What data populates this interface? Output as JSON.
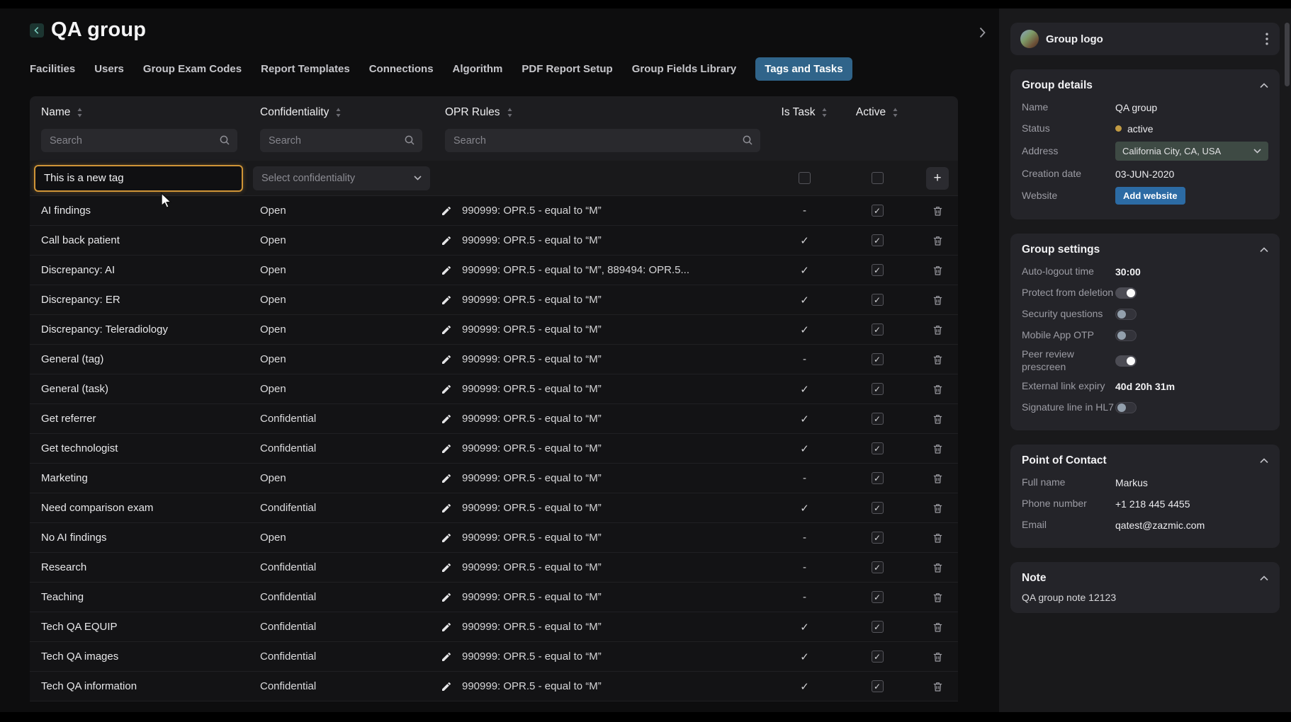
{
  "header": {
    "title": "QA group"
  },
  "tabs": {
    "items": [
      {
        "label": "Facilities",
        "active": false
      },
      {
        "label": "Users",
        "active": false
      },
      {
        "label": "Group Exam Codes",
        "active": false
      },
      {
        "label": "Report Templates",
        "active": false
      },
      {
        "label": "Connections",
        "active": false
      },
      {
        "label": "Algorithm",
        "active": false
      },
      {
        "label": "PDF Report Setup",
        "active": false
      },
      {
        "label": "Group Fields Library",
        "active": false
      },
      {
        "label": "Tags and Tasks",
        "active": true
      }
    ]
  },
  "table": {
    "columns": [
      {
        "label": "Name"
      },
      {
        "label": "Confidentiality"
      },
      {
        "label": "OPR Rules"
      },
      {
        "label": "Is Task"
      },
      {
        "label": "Active"
      }
    ],
    "search_placeholder": "Search",
    "glyphs": {
      "task_yes": "✓",
      "task_no": "-"
    },
    "new_row": {
      "name_value": "This is a new tag",
      "confidentiality_placeholder": "Select confidentiality",
      "add_label": "+"
    },
    "rows": [
      {
        "name": "AI findings",
        "confidentiality": "Open",
        "opr_rules": "990999: OPR.5 - equal to “M”",
        "is_task": false,
        "active": true
      },
      {
        "name": "Call back patient",
        "confidentiality": "Open",
        "opr_rules": "990999: OPR.5 - equal to “M”",
        "is_task": true,
        "active": true
      },
      {
        "name": "Discrepancy: AI",
        "confidentiality": "Open",
        "opr_rules": "990999: OPR.5 - equal to “M”, 889494: OPR.5...",
        "is_task": true,
        "active": true
      },
      {
        "name": "Discrepancy: ER",
        "confidentiality": "Open",
        "opr_rules": "990999: OPR.5 - equal to “M”",
        "is_task": true,
        "active": true
      },
      {
        "name": "Discrepancy: Teleradiology",
        "confidentiality": "Open",
        "opr_rules": "990999: OPR.5 - equal to “M”",
        "is_task": true,
        "active": true
      },
      {
        "name": "General (tag)",
        "confidentiality": "Open",
        "opr_rules": "990999: OPR.5 - equal to “M”",
        "is_task": false,
        "active": true
      },
      {
        "name": "General (task)",
        "confidentiality": "Open",
        "opr_rules": "990999: OPR.5 - equal to “M”",
        "is_task": true,
        "active": true
      },
      {
        "name": "Get referrer",
        "confidentiality": "Confidential",
        "opr_rules": "990999: OPR.5 - equal to “M”",
        "is_task": true,
        "active": true
      },
      {
        "name": "Get technologist",
        "confidentiality": "Confidential",
        "opr_rules": "990999: OPR.5 - equal to “M”",
        "is_task": true,
        "active": true
      },
      {
        "name": "Marketing",
        "confidentiality": "Open",
        "opr_rules": "990999: OPR.5 - equal to “M”",
        "is_task": false,
        "active": true
      },
      {
        "name": "Need comparison exam",
        "confidentiality": "Condifential",
        "opr_rules": "990999: OPR.5 - equal to “M”",
        "is_task": true,
        "active": true
      },
      {
        "name": "No AI findings",
        "confidentiality": "Open",
        "opr_rules": "990999: OPR.5 - equal to “M”",
        "is_task": false,
        "active": true
      },
      {
        "name": "Research",
        "confidentiality": "Confidential",
        "opr_rules": "990999: OPR.5 - equal to “M”",
        "is_task": false,
        "active": true
      },
      {
        "name": "Teaching",
        "confidentiality": "Confidential",
        "opr_rules": "990999: OPR.5 - equal to “M”",
        "is_task": false,
        "active": true
      },
      {
        "name": "Tech QA EQUIP",
        "confidentiality": "Confidential",
        "opr_rules": "990999: OPR.5 - equal to “M”",
        "is_task": true,
        "active": true
      },
      {
        "name": "Tech QA images",
        "confidentiality": "Confidential",
        "opr_rules": "990999: OPR.5 - equal to “M”",
        "is_task": true,
        "active": true
      },
      {
        "name": "Tech QA information",
        "confidentiality": "Confidential",
        "opr_rules": "990999: OPR.5 - equal to “M”",
        "is_task": true,
        "active": true
      }
    ]
  },
  "panel": {
    "logo_label": "Group logo",
    "group_details": {
      "title": "Group details",
      "fields": [
        {
          "label": "Name",
          "type": "text",
          "value": "QA group"
        },
        {
          "label": "Status",
          "type": "status",
          "value": "active"
        },
        {
          "label": "Address",
          "type": "select",
          "value": "California City, CA, USA"
        },
        {
          "label": "Creation date",
          "type": "text",
          "value": "03-JUN-2020"
        },
        {
          "label": "Website",
          "type": "button",
          "value": "Add website"
        }
      ]
    },
    "group_settings": {
      "title": "Group settings",
      "rows": [
        {
          "label": "Auto-logout time",
          "type": "text",
          "value": "30:00"
        },
        {
          "label": "Protect from deletion",
          "type": "toggle",
          "on": true
        },
        {
          "label": "Security questions",
          "type": "toggle",
          "on": false
        },
        {
          "label": "Mobile App OTP",
          "type": "toggle",
          "on": false
        },
        {
          "label": "Peer review prescreen",
          "type": "toggle",
          "on": true
        },
        {
          "label": "External link expiry",
          "type": "text",
          "value": "40d 20h 31m"
        },
        {
          "label": "Signature line in HL7",
          "type": "toggle",
          "on": false
        }
      ]
    },
    "point_of_contact": {
      "title": "Point of Contact",
      "fields": [
        {
          "label": "Full name",
          "value": "Markus"
        },
        {
          "label": "Phone number",
          "value": "+1 218 445 4455"
        },
        {
          "label": "Email",
          "value": "qatest@zazmic.com"
        }
      ]
    },
    "note": {
      "title": "Note",
      "text": "QA group note 12123"
    }
  },
  "colors": {
    "accent_tab": "#30648a",
    "highlight_orange": "#cf9437",
    "button_blue": "#2c6ba4",
    "status_active": "#c29b43"
  }
}
